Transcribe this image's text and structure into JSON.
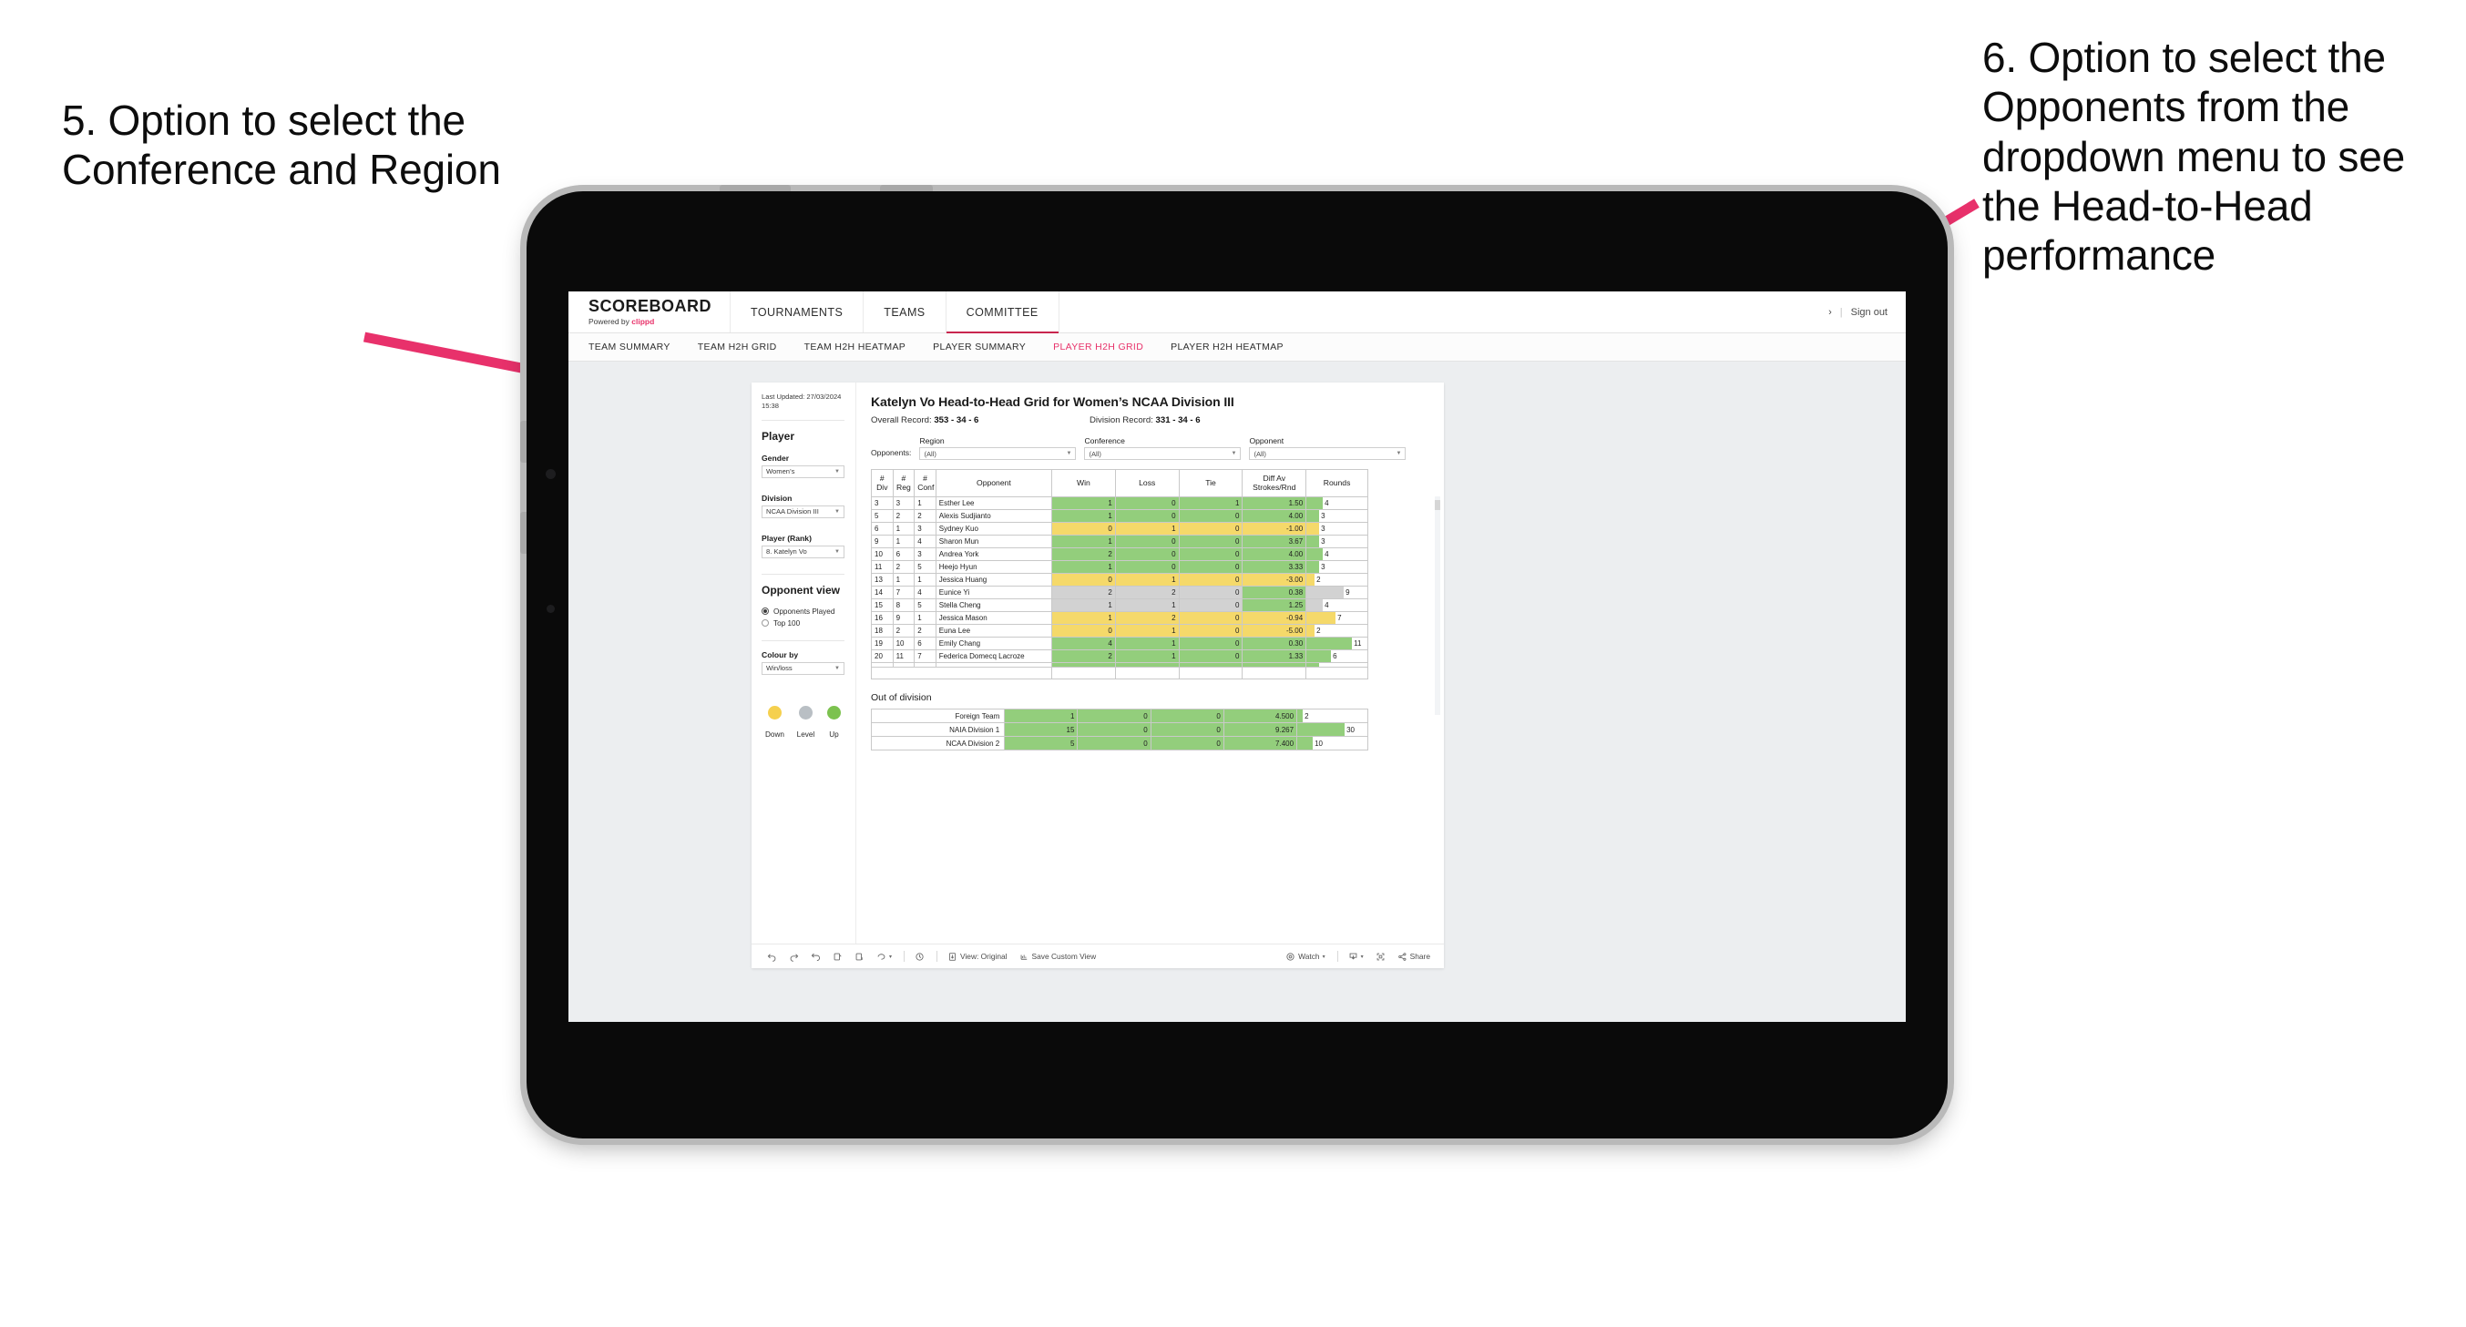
{
  "annotations": {
    "left": "5. Option to select the Conference and Region",
    "right": "6. Option to select the Opponents from the dropdown menu to see the Head-to-Head performance",
    "arrow_color": "#e8316b"
  },
  "app": {
    "brand": {
      "title": "SCOREBOARD",
      "powered_prefix": "Powered by ",
      "powered_brand": "clippd"
    },
    "nav": [
      {
        "label": "TOURNAMENTS",
        "active": false
      },
      {
        "label": "TEAMS",
        "active": false
      },
      {
        "label": "COMMITTEE",
        "active": true
      }
    ],
    "account": {
      "chevron": "›",
      "separator": "|",
      "sign_out": "Sign out"
    },
    "subnav": [
      {
        "label": "TEAM SUMMARY",
        "active": false
      },
      {
        "label": "TEAM H2H GRID",
        "active": false
      },
      {
        "label": "TEAM H2H HEATMAP",
        "active": false
      },
      {
        "label": "PLAYER SUMMARY",
        "active": false
      },
      {
        "label": "PLAYER H2H GRID",
        "active": true
      },
      {
        "label": "PLAYER H2H HEATMAP",
        "active": false
      }
    ]
  },
  "sidebar": {
    "last_updated": "Last Updated: 27/03/2024 15:38",
    "section_player": "Player",
    "fields": [
      {
        "label": "Gender",
        "value": "Women’s"
      },
      {
        "label": "Division",
        "value": "NCAA Division III"
      },
      {
        "label": "Player (Rank)",
        "value": "8. Katelyn Vo"
      }
    ],
    "opponent_view": {
      "title": "Opponent view",
      "options": [
        {
          "label": "Opponents Played",
          "selected": true
        },
        {
          "label": "Top 100",
          "selected": false
        }
      ]
    },
    "colour_by": {
      "label": "Colour by",
      "value": "Win/loss"
    },
    "legend": [
      {
        "label": "Down",
        "color": "#f5d04e"
      },
      {
        "label": "Level",
        "color": "#b9bfc4"
      },
      {
        "label": "Up",
        "color": "#7cc24f"
      }
    ]
  },
  "main": {
    "title": "Katelyn Vo Head-to-Head Grid for Women’s NCAA Division III",
    "overall_record_label": "Overall Record:",
    "overall_record_value": "353 - 34 - 6",
    "division_record_label": "Division Record:",
    "division_record_value": "331 - 34 - 6",
    "opponents_label": "Opponents:",
    "filters": [
      {
        "label": "Region",
        "value": "(All)"
      },
      {
        "label": "Conference",
        "value": "(All)"
      },
      {
        "label": "Opponent",
        "value": "(All)"
      }
    ],
    "out_of_division_title": "Out of division"
  },
  "chart_data": {
    "type": "table",
    "title": "Katelyn Vo Head-to-Head Grid for Women’s NCAA Division III",
    "columns": [
      "# Div",
      "# Reg",
      "# Conf",
      "Opponent",
      "Win",
      "Loss",
      "Tie",
      "Diff Av Strokes/Rnd",
      "Rounds"
    ],
    "column_headers_multiline": [
      [
        "#",
        "Div"
      ],
      [
        "#",
        "Reg"
      ],
      [
        "#",
        "Conf"
      ],
      [
        "Opponent"
      ],
      [
        "Win"
      ],
      [
        "Loss"
      ],
      [
        "Tie"
      ],
      [
        "Diff Av",
        "Strokes/Rnd"
      ],
      [
        "Rounds"
      ]
    ],
    "rounds_max": 11,
    "rows": [
      {
        "div": "3",
        "reg": "3",
        "conf": "1",
        "opponent": "Esther Lee",
        "win": "1",
        "loss": "0",
        "tie": "1",
        "diff": "1.50",
        "rounds": 4,
        "color": "green"
      },
      {
        "div": "5",
        "reg": "2",
        "conf": "2",
        "opponent": "Alexis Sudjianto",
        "win": "1",
        "loss": "0",
        "tie": "0",
        "diff": "4.00",
        "rounds": 3,
        "color": "green"
      },
      {
        "div": "6",
        "reg": "1",
        "conf": "3",
        "opponent": "Sydney Kuo",
        "win": "0",
        "loss": "1",
        "tie": "0",
        "diff": "-1.00",
        "rounds": 3,
        "color": "yellow"
      },
      {
        "div": "9",
        "reg": "1",
        "conf": "4",
        "opponent": "Sharon Mun",
        "win": "1",
        "loss": "0",
        "tie": "0",
        "diff": "3.67",
        "rounds": 3,
        "color": "green"
      },
      {
        "div": "10",
        "reg": "6",
        "conf": "3",
        "opponent": "Andrea York",
        "win": "2",
        "loss": "0",
        "tie": "0",
        "diff": "4.00",
        "rounds": 4,
        "color": "green"
      },
      {
        "div": "11",
        "reg": "2",
        "conf": "5",
        "opponent": "Heejo Hyun",
        "win": "1",
        "loss": "0",
        "tie": "0",
        "diff": "3.33",
        "rounds": 3,
        "color": "green"
      },
      {
        "div": "13",
        "reg": "1",
        "conf": "1",
        "opponent": "Jessica Huang",
        "win": "0",
        "loss": "1",
        "tie": "0",
        "diff": "-3.00",
        "rounds": 2,
        "color": "yellow"
      },
      {
        "div": "14",
        "reg": "7",
        "conf": "4",
        "opponent": "Eunice Yi",
        "win": "2",
        "loss": "2",
        "tie": "0",
        "diff": "0.38",
        "rounds": 9,
        "color": "grey",
        "diff_color": "green"
      },
      {
        "div": "15",
        "reg": "8",
        "conf": "5",
        "opponent": "Stella Cheng",
        "win": "1",
        "loss": "1",
        "tie": "0",
        "diff": "1.25",
        "rounds": 4,
        "color": "grey",
        "diff_color": "green"
      },
      {
        "div": "16",
        "reg": "9",
        "conf": "1",
        "opponent": "Jessica Mason",
        "win": "1",
        "loss": "2",
        "tie": "0",
        "diff": "-0.94",
        "rounds": 7,
        "color": "yellow"
      },
      {
        "div": "18",
        "reg": "2",
        "conf": "2",
        "opponent": "Euna Lee",
        "win": "0",
        "loss": "1",
        "tie": "0",
        "diff": "-5.00",
        "rounds": 2,
        "color": "yellow"
      },
      {
        "div": "19",
        "reg": "10",
        "conf": "6",
        "opponent": "Emily Chang",
        "win": "4",
        "loss": "1",
        "tie": "0",
        "diff": "0.30",
        "rounds": 11,
        "color": "green"
      },
      {
        "div": "20",
        "reg": "11",
        "conf": "7",
        "opponent": "Federica Domecq Lacroze",
        "win": "2",
        "loss": "1",
        "tie": "0",
        "diff": "1.33",
        "rounds": 6,
        "color": "green"
      }
    ],
    "out_of_division": {
      "title": "Out of division",
      "rounds_max": 30,
      "rows": [
        {
          "name": "Foreign Team",
          "win": "1",
          "loss": "0",
          "tie": "0",
          "diff": "4.500",
          "rounds": 2,
          "color": "green"
        },
        {
          "name": "NAIA Division 1",
          "win": "15",
          "loss": "0",
          "tie": "0",
          "diff": "9.267",
          "rounds": 30,
          "color": "green"
        },
        {
          "name": "NCAA Division 2",
          "win": "5",
          "loss": "0",
          "tie": "0",
          "diff": "7.400",
          "rounds": 10,
          "color": "green"
        }
      ]
    },
    "colors": {
      "green": "#93ce7c",
      "yellow": "#f5d96a",
      "grey": "#d2d2d2"
    }
  },
  "toolbar": {
    "view_label": "View: Original",
    "save_label": "Save Custom View",
    "watch_label": "Watch",
    "share_label": "Share",
    "caret": "▾"
  }
}
